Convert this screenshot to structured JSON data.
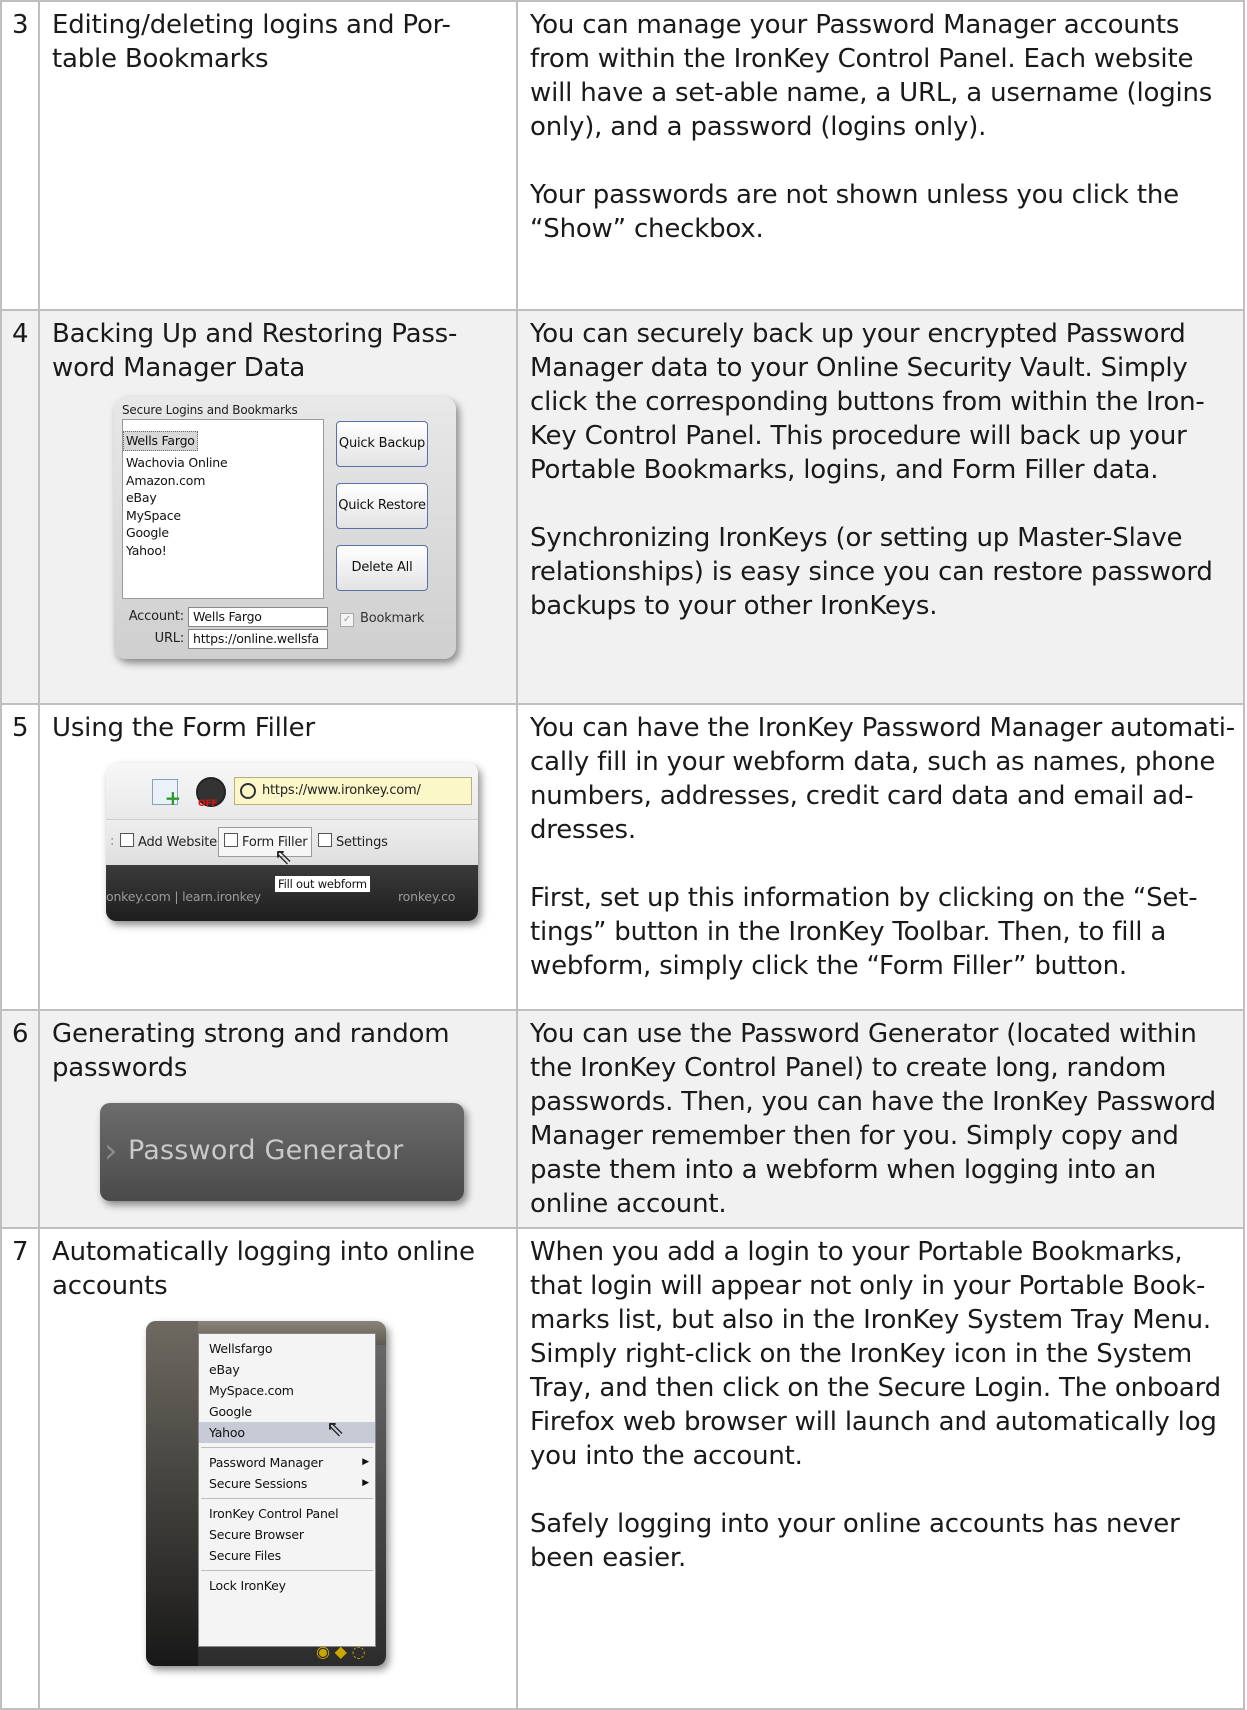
{
  "rows": [
    {
      "num": "3",
      "title": "Editing/deleting logins and Por-table Bookmarks",
      "desc": [
        "You can manage your Password Manager accounts from within the IronKey Control Panel.  Each website will have a set-able name, a URL, a username (logins only), and a password (logins only).",
        "Your passwords are not shown unless you click the “Show” checkbox."
      ]
    },
    {
      "num": "4",
      "title": "Backing Up and Restoring Pass-word Manager Data",
      "desc": [
        "You can securely back up your encrypted Password Manager data to your Online Security Vault.  Simply click the corresponding buttons from within the Iron-Key Control Panel.  This procedure will back up your Portable Bookmarks, logins, and Form Filler data.",
        "Synchronizing IronKeys (or setting up Master-Slave relationships) is easy since you can restore password backups to your other IronKeys."
      ]
    },
    {
      "num": "5",
      "title": "Using the Form Filler",
      "desc": [
        "You can have the IronKey Password Manager automati-cally fill in your webform data, such as names, phone numbers, addresses, credit card data and email ad-dresses.",
        "First, set up this information by clicking on the “Set-tings” button in the IronKey Toolbar. Then, to fill a webform, simply click the “Form Filler” button."
      ]
    },
    {
      "num": "6",
      "title": "Generating strong and random passwords",
      "desc": [
        "You can use the Password Generator (located within the IronKey Control Panel) to create long, random passwords.  Then, you can have the IronKey Password Manager remember then for you.  Simply copy and paste them into a webform when logging into an online account."
      ]
    },
    {
      "num": "7",
      "title": "Automatically logging into online accounts",
      "desc": [
        "When you add a login to your Portable Bookmarks, that login will appear not only in your Portable Book-marks list, but also in the IronKey System Tray Menu.  Simply right-click on the IronKey icon in the System Tray, and then click on the Secure Login. The onboard Firefox web browser will launch and automatically log you into the account.",
        "Safely logging into your online accounts has never been easier."
      ]
    }
  ],
  "backup_widget": {
    "legend": "Secure Logins and Bookmarks",
    "items": [
      "Wells Fargo",
      "Wachovia Online",
      "Amazon.com",
      "eBay",
      "MySpace",
      "Google",
      "Yahoo!"
    ],
    "buttons": [
      "Quick Backup",
      "Quick Restore",
      "Delete All"
    ],
    "account_label": "Account:",
    "account_value": "Wells Fargo",
    "url_label": "URL:",
    "url_value": "https://online.wellsfa",
    "bookmark_label": "Bookmark"
  },
  "form_filler": {
    "off_label": "OFF",
    "url": "https://www.ironkey.com/",
    "add_website": "Add Website",
    "form_filler": "Form Filler",
    "settings": "Settings",
    "footer_left": "onkey.com | learn.ironkey",
    "footer_right": "ronkey.co",
    "tooltip": "Fill out webform"
  },
  "password_generator": {
    "label": "Password Generator"
  },
  "tray_menu": {
    "logins": [
      "Wellsfargo",
      "eBay",
      "MySpace.com",
      "Google",
      "Yahoo"
    ],
    "submenus": [
      "Password Manager",
      "Secure Sessions"
    ],
    "apps": [
      "IronKey Control Panel",
      "Secure Browser",
      "Secure Files"
    ],
    "lock": "Lock IronKey"
  }
}
